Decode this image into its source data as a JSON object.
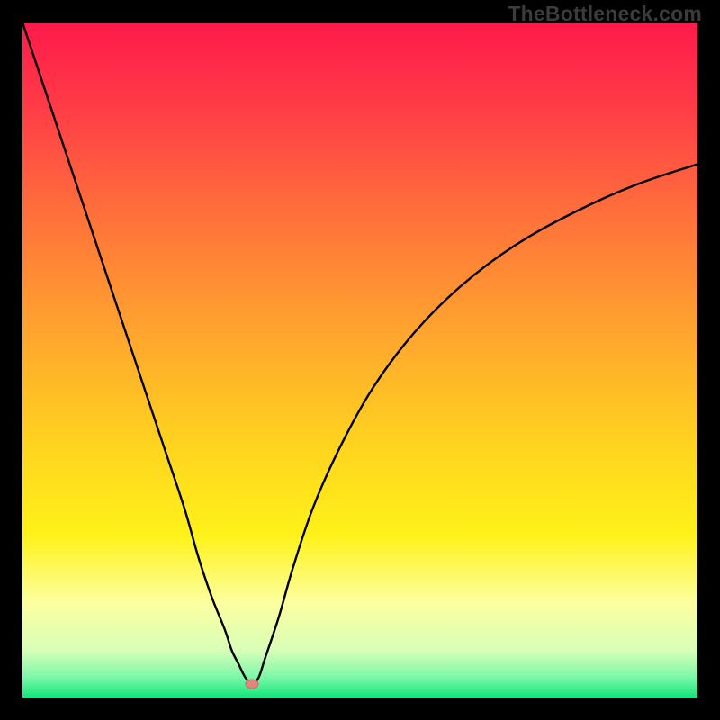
{
  "watermark": "TheBottleneck.com",
  "colors": {
    "frame_bg": "#000000",
    "curve": "#000000",
    "marker_fill": "#e2857c",
    "marker_stroke": "#c96a61",
    "gradient_stops": [
      {
        "offset": 0,
        "color": "#ff1a4b"
      },
      {
        "offset": 12,
        "color": "#ff3a47"
      },
      {
        "offset": 28,
        "color": "#ff6f3b"
      },
      {
        "offset": 45,
        "color": "#ffa22f"
      },
      {
        "offset": 62,
        "color": "#ffd21f"
      },
      {
        "offset": 76,
        "color": "#fff21a"
      },
      {
        "offset": 86,
        "color": "#fcffa0"
      },
      {
        "offset": 93,
        "color": "#d8ffb8"
      },
      {
        "offset": 97,
        "color": "#7cf7a8"
      },
      {
        "offset": 100,
        "color": "#13e67a"
      }
    ]
  },
  "chart_data": {
    "type": "line",
    "title": "",
    "xlabel": "",
    "ylabel": "",
    "xlim": [
      0,
      100
    ],
    "ylim": [
      0,
      100
    ],
    "annotations": [
      {
        "name": "optimum",
        "x": 34,
        "y": 2
      }
    ],
    "series": [
      {
        "name": "bottleneck-curve",
        "x": [
          0,
          3,
          6,
          9,
          12,
          15,
          18,
          21,
          24,
          26,
          28,
          30,
          31,
          32,
          33,
          34,
          35,
          36,
          38,
          40,
          43,
          47,
          52,
          58,
          65,
          73,
          82,
          91,
          100
        ],
        "y": [
          100,
          91,
          82,
          73,
          64,
          55,
          46,
          37,
          28,
          21,
          15,
          10,
          7,
          5,
          3,
          2,
          3,
          6,
          12,
          19,
          28,
          37,
          46,
          54,
          61,
          67,
          72,
          76,
          79
        ]
      }
    ]
  }
}
